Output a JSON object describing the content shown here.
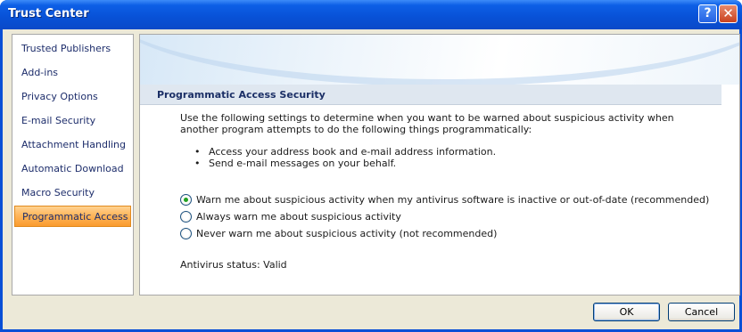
{
  "window": {
    "title": "Trust Center",
    "help_glyph": "?",
    "close_glyph": "✕"
  },
  "nav": {
    "items": [
      {
        "label": "Trusted Publishers"
      },
      {
        "label": "Add-ins"
      },
      {
        "label": "Privacy Options"
      },
      {
        "label": "E-mail Security"
      },
      {
        "label": "Attachment Handling"
      },
      {
        "label": "Automatic Download"
      },
      {
        "label": "Macro Security"
      },
      {
        "label": "Programmatic Access",
        "selected": true
      }
    ]
  },
  "content": {
    "section_title": "Programmatic Access Security",
    "description": "Use the following settings to determine when you want to be warned about suspicious activity when another program attempts to do the following things programmatically:",
    "bullets": [
      "Access your address book and e-mail address information.",
      "Send e-mail messages on your behalf."
    ],
    "options": [
      {
        "label": "Warn me about suspicious activity when my antivirus software is inactive or out-of-date (recommended)",
        "selected": true
      },
      {
        "label": "Always warn me about suspicious activity",
        "selected": false
      },
      {
        "label": "Never warn me about suspicious activity (not recommended)",
        "selected": false
      }
    ],
    "antivirus_status": "Antivirus status: Valid"
  },
  "buttons": {
    "ok": "OK",
    "cancel": "Cancel"
  },
  "colors": {
    "titlebar": "#0a52d8",
    "selected_nav": "#ffb65c",
    "client_bg": "#ece9d8"
  }
}
